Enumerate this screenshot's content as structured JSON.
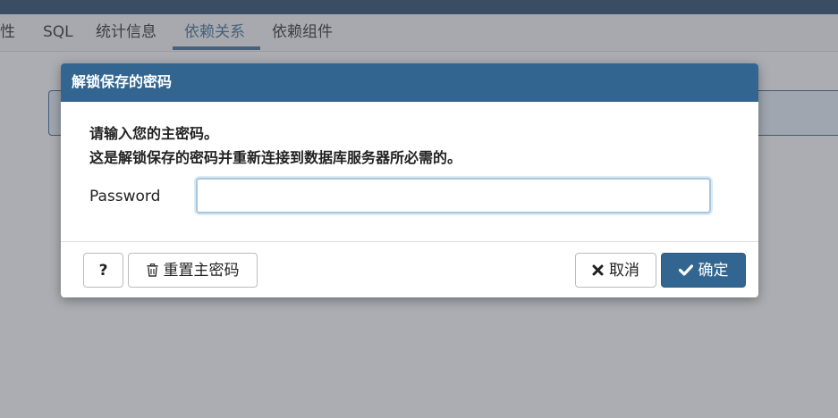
{
  "tabs": [
    {
      "label": "属性"
    },
    {
      "label": "SQL"
    },
    {
      "label": "统计信息"
    },
    {
      "label": "依赖关系",
      "active": true
    },
    {
      "label": "依赖组件"
    }
  ],
  "dialog": {
    "title": "解锁保存的密码",
    "message_line1": "请输入您的主密码。",
    "message_line2": "这是解锁保存的密码并重新连接到数据库服务器所必需的。",
    "password_label": "Password",
    "password_value": "",
    "help_label": "?",
    "reset_label": "重置主密码",
    "cancel_label": "取消",
    "ok_label": "确定"
  },
  "icons": {
    "reset": "trash-icon",
    "cancel": "close-icon",
    "ok": "check-icon"
  },
  "colors": {
    "primary": "#326690",
    "topbar": "#1d3e5f"
  }
}
